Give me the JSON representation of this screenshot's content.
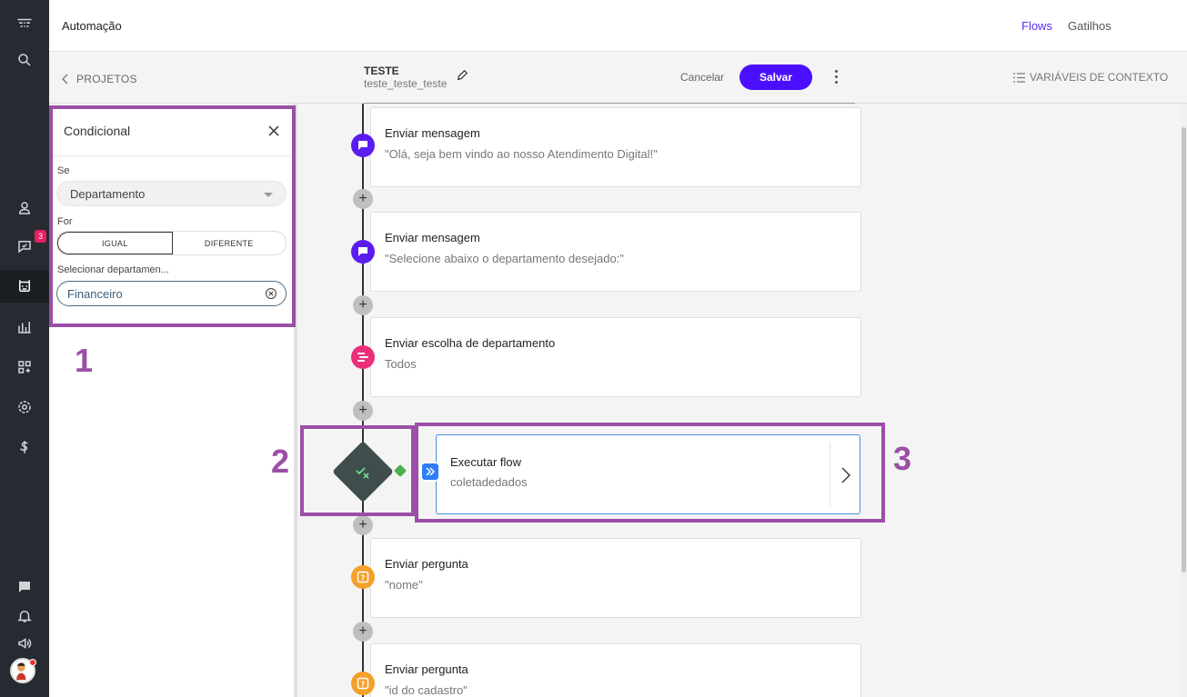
{
  "header": {
    "app_title": "Automação",
    "links": [
      "Flows",
      "Gatilhos"
    ]
  },
  "subheader": {
    "back_label": "PROJETOS",
    "flow_name": "TESTE",
    "flow_id": "teste_teste_teste",
    "cancel_label": "Cancelar",
    "save_label": "Salvar",
    "context_label": "VARIÁVEIS DE CONTEXTO"
  },
  "nav": {
    "badge_count": "3",
    "icons": [
      "logo-icon",
      "search-icon",
      "contacts-icon",
      "chat-icon",
      "bot-icon",
      "reports-icon",
      "apps-icon",
      "settings-icon",
      "billing-icon",
      "message-icon",
      "bell-icon",
      "megaphone-icon"
    ]
  },
  "panel": {
    "title": "Condicional",
    "if_label": "Se",
    "if_value": "Departamento",
    "for_label": "For",
    "options": [
      "IGUAL",
      "DIFERENTE"
    ],
    "selected_option": "IGUAL",
    "dept_label": "Selecionar departamen...",
    "dept_value": "Financeiro"
  },
  "annotations": [
    "1",
    "2",
    "3"
  ],
  "flow": {
    "steps": [
      {
        "title": "Enviar mensagem",
        "detail": "\"Olá, seja bem vindo ao nosso Atendimento Digital!\"",
        "icon": "message-icon",
        "color": "#5b1cf0"
      },
      {
        "title": "Enviar mensagem",
        "detail": "\"Selecione abaixo o departamento desejado:\"",
        "icon": "message-icon",
        "color": "#5b1cf0"
      },
      {
        "title": "Enviar escolha de departamento",
        "detail": "Todos",
        "icon": "department-icon",
        "color": "#ec2f7a"
      },
      {
        "title": "Enviar pergunta",
        "detail": "\"nome\"",
        "icon": "question-icon",
        "color": "#f5a02a"
      },
      {
        "title": "Enviar pergunta",
        "detail": "\"id do cadastro\"",
        "icon": "question-icon",
        "color": "#f5a02a"
      }
    ],
    "exec": {
      "title": "Executar flow",
      "detail": "coletadedados",
      "icon": "execute-flow-icon",
      "color": "#2e7df6"
    },
    "condition_icon": "condition-icon",
    "condition_color": "#3f4d4d"
  }
}
